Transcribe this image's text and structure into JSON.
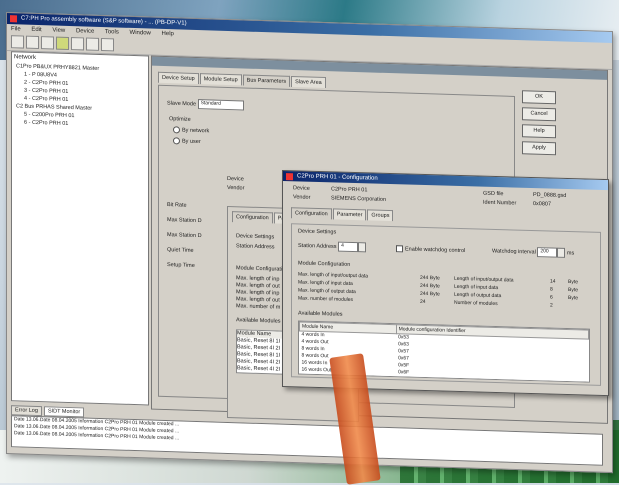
{
  "app": {
    "title": "C7:PH Pro assembly software (S&P software) - ... (PB-DP-V1)",
    "menu": [
      "File",
      "Edit",
      "View",
      "Device",
      "Tools",
      "Window",
      "Help"
    ]
  },
  "tree": {
    "header": "Network",
    "items": [
      {
        "label": "C1Pro PB&UX PRHY8821 Master",
        "child": false
      },
      {
        "label": "1 - P 08U8V4",
        "child": true
      },
      {
        "label": "2 - C2Pro PRH 01",
        "child": true
      },
      {
        "label": "3 - C2Pro PRH 01",
        "child": true
      },
      {
        "label": "4 - C2Pro PRH 01",
        "child": true
      },
      {
        "label": "C2 Bus PRHAS Shared Master",
        "child": false
      },
      {
        "label": "5 - C200Pro PRH 01",
        "child": true
      },
      {
        "label": "6 - C2Pro PRH 01",
        "child": true
      }
    ]
  },
  "main": {
    "tabs": [
      "Device Setup",
      "Module Setup",
      "Bus Parameters",
      "Slave Area"
    ],
    "buttons": [
      "OK",
      "Cancel",
      "Help",
      "Apply"
    ],
    "mode_label": "Slave Mode",
    "mode_value": "Standard",
    "optimize_label": "Optimize",
    "radio1": "By network",
    "radio2": "By user",
    "side_labels": [
      "Bit Rate",
      "Max Station D",
      "Max Station D",
      "Quiet Time",
      "Setup Time"
    ],
    "mid_device_label": "Device",
    "mid_vendor_label": "Vendor",
    "mid_tabs": [
      "Configuration",
      "Parameter"
    ],
    "mid_section": "Device Settings",
    "mid_station": "Station Address",
    "mid_module_config": "Module Configuration",
    "mid_lines": [
      "Max. length of inp",
      "Max. length of out",
      "Max. length of inp",
      "Max. length of out",
      "Max. number of m"
    ],
    "mid_available": "Available Modules",
    "mid_modules": [
      "Module Name",
      "Basic, Reset 8I 1I",
      "Basic, Reset 4I 2I",
      "Basic, Reset 8I 1I",
      "Basic, Reset 4I 2I",
      "Basic, Reset 4I 2I"
    ]
  },
  "dialog": {
    "title": "C2Pro PRH 01 - Configuration",
    "device_label": "Device",
    "device_value": "C2Pro PRH 01",
    "vendor_label": "Vendor",
    "vendor_value": "SIEMENS Corporation",
    "gsd_label": "GSD file",
    "gsd_value": "PD_0888.gsd",
    "ident_label": "Ident Number",
    "ident_value": "0x0807",
    "tabs": [
      "Configuration",
      "Parameter",
      "Groups"
    ],
    "section_device": "Device Settings",
    "station_label": "Station Address",
    "station_value": "4",
    "enable_label": "Enable watchdog control",
    "interval_label": "Watchdog interval",
    "interval_value": "200",
    "interval_unit": "ms",
    "module_config_title": "Module Configuration",
    "config_rows": [
      {
        "label": "Max. length of input/output data",
        "v1": "244 Byte",
        "l2": "Length of input/output data",
        "v2": "14",
        "u": "Byte"
      },
      {
        "label": "Max. length of input data",
        "v1": "244 Byte",
        "l2": "Length of input data",
        "v2": "8",
        "u": "Byte"
      },
      {
        "label": "Max. length of output data",
        "v1": "244 Byte",
        "l2": "Length of output data",
        "v2": "6",
        "u": "Byte"
      },
      {
        "label": "Max. number of modules",
        "v1": "24",
        "l2": "Number of modules",
        "v2": "2",
        "u": ""
      }
    ],
    "available_title": "Available Modules",
    "modules_cols": [
      "Module Name",
      "Module configuration Identifier"
    ],
    "modules": [
      [
        "4 words In",
        "0x53"
      ],
      [
        "4 words Out",
        "0x63"
      ],
      [
        "8 words In",
        "0x57"
      ],
      [
        "8 words Out",
        "0x67"
      ],
      [
        "16 words In",
        "0x5F"
      ],
      [
        "16 words Out",
        "0x6F"
      ]
    ]
  },
  "bottom": {
    "tabs": [
      "Error Log",
      "SIDT Monitor"
    ],
    "log": [
      "Date  13.06.Date  08.04.2005  Information  C2Pro PRH 01  Module  created  ...",
      "Date  13.06.Date  08.04.2005  Information  C2Pro PRH 01  Module  created  ...",
      "Date  13.06.Date  08.04.2005  Information  C2Pro PRH 01  Module  created  ..."
    ]
  }
}
